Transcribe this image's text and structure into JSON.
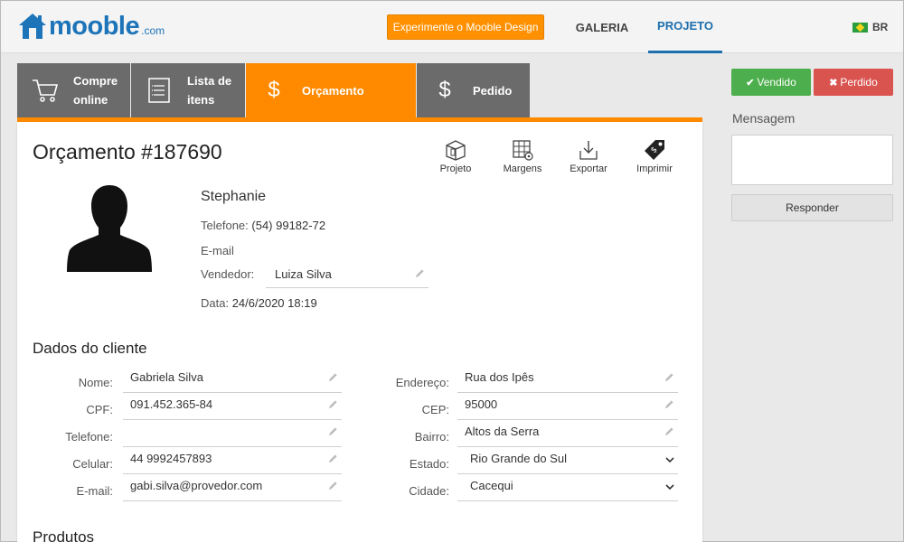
{
  "header": {
    "logo_text": "mooble",
    "logo_suffix": ".com",
    "try_button": "Experimente o Mooble Design",
    "nav": [
      {
        "label": "GALERIA",
        "icon": ""
      },
      {
        "label": "PROJETO",
        "icon": ""
      }
    ],
    "lang": "BR",
    "accent": "#1d6fae",
    "orange": "#ff8a00"
  },
  "tabs": [
    {
      "label_line1": "Compre",
      "label_line2": "online",
      "icon": "cart-icon"
    },
    {
      "label_line1": "Lista de",
      "label_line2": "itens",
      "icon": "list-icon"
    },
    {
      "label_line1": "Orçamento",
      "label_line2": "",
      "icon": "dollar-icon"
    },
    {
      "label_line1": "Pedido",
      "label_line2": "",
      "icon": "dollar-icon"
    }
  ],
  "budget": {
    "title": "Orçamento #187690",
    "actions": [
      "Projeto",
      "Margens",
      "Exportar",
      "Imprimir"
    ],
    "name": "Stephanie",
    "phone_label": "Telefone:",
    "phone": "(54) 99182-72",
    "email_label": "E-mail",
    "seller_label": "Vendedor:",
    "seller": "Luiza Silva",
    "date_label": "Data:",
    "date": "24/6/2020 18:19"
  },
  "client": {
    "section_title": "Dados do cliente",
    "left": [
      {
        "label": "Nome:",
        "value": "Gabriela Silva"
      },
      {
        "label": "CPF:",
        "value": "091.452.365-84"
      },
      {
        "label": "Telefone:",
        "value": ""
      },
      {
        "label": "Celular:",
        "value": "44 9992457893"
      },
      {
        "label": "E-mail:",
        "value": "gabi.silva@provedor.com"
      }
    ],
    "right": [
      {
        "label": "Endereço:",
        "value": "Rua dos Ipês",
        "type": "text"
      },
      {
        "label": "CEP:",
        "value": "95000",
        "type": "text"
      },
      {
        "label": "Bairro:",
        "value": "Altos da Serra",
        "type": "text"
      },
      {
        "label": "Estado:",
        "value": "Rio Grande do Sul",
        "type": "select"
      },
      {
        "label": "Cidade:",
        "value": "Cacequi",
        "type": "select"
      }
    ]
  },
  "products": {
    "section_title": "Produtos"
  },
  "side": {
    "sold_label": "Vendido",
    "lost_label": "Perdido",
    "sold_color": "#4cae4c",
    "lost_color": "#d9534f",
    "message_label": "Mensagem",
    "message_value": "",
    "reply_label": "Responder"
  }
}
